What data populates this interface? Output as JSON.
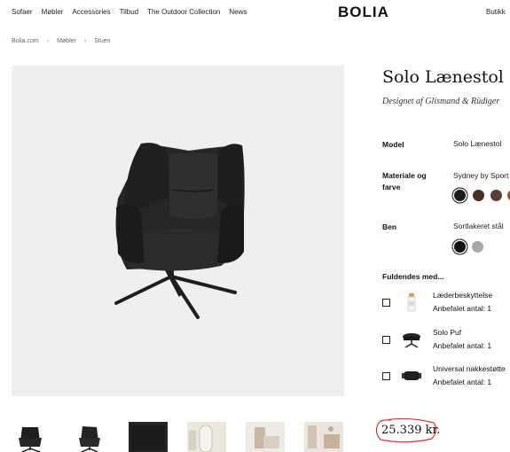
{
  "header": {
    "nav": [
      "Sofaer",
      "Møbler",
      "Accessories",
      "Tilbud",
      "The Outdoor Collection",
      "News"
    ],
    "logo": "BOLIA",
    "right_link": "Butikk"
  },
  "breadcrumb": [
    "Bolia.com",
    "Møbler",
    "Stuen"
  ],
  "product": {
    "title": "Solo Lænestol",
    "subtitle": "Designet af Glismand & Rüdiger",
    "model_label": "Model",
    "model_value": "Solo Lænestol",
    "material_label": "Materiale og farve",
    "material_value": "Sydney by Sport",
    "material_swatches": [
      "#1c1c1c",
      "#4a2f24",
      "#5a4034",
      "#8a5a3a"
    ],
    "legs_label": "Ben",
    "legs_value": "Sortlakeret stål",
    "legs_swatches": [
      "#111111",
      "#a8a8a8"
    ]
  },
  "addons": {
    "heading": "Fuldendes med...",
    "items": [
      {
        "name": "Læderbeskyttelse",
        "qty": "Anbefalet antal: 1",
        "icon": "bottle-icon"
      },
      {
        "name": "Solo Puf",
        "qty": "Anbefalet antal: 1",
        "icon": "pouf-icon"
      },
      {
        "name": "Universal nakkestøtte",
        "qty": "Anbefalet antal: 1",
        "icon": "headrest-icon"
      }
    ]
  },
  "price": "25.339 kr.",
  "colors": {
    "image_bg": "#efefef",
    "price_circle": "#d9362b"
  }
}
